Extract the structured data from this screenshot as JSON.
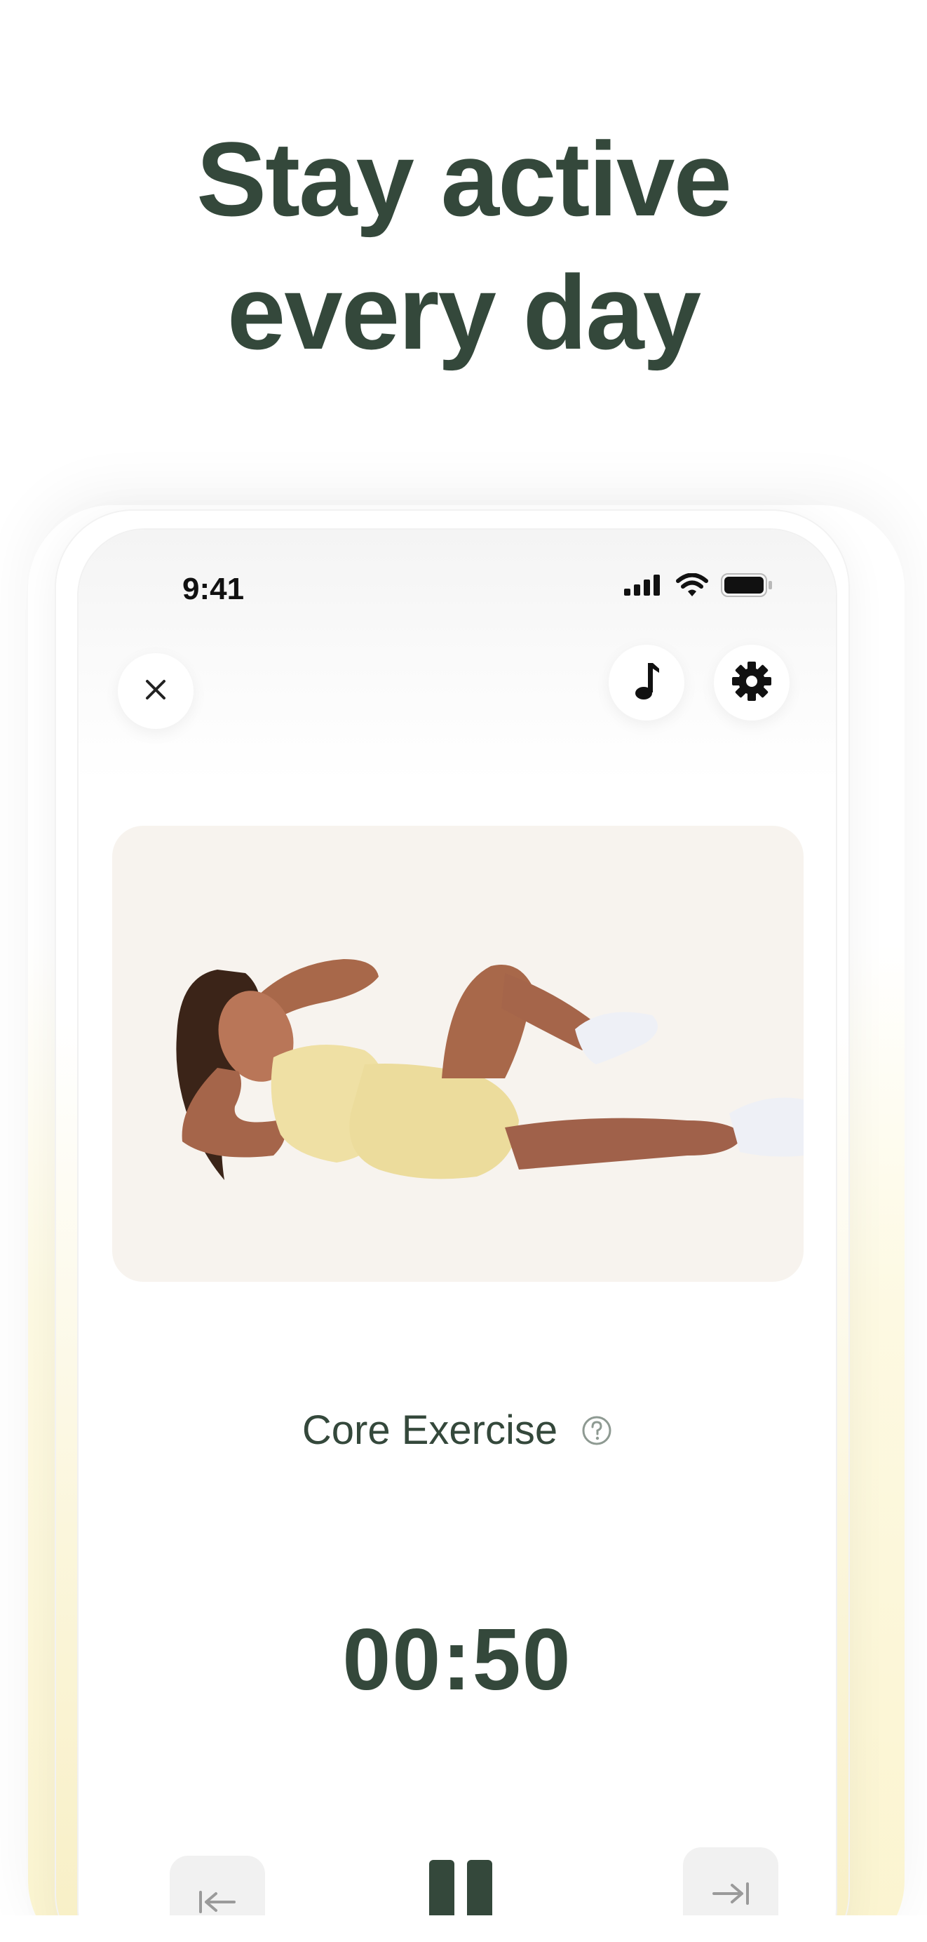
{
  "headline": {
    "line1": "Stay active",
    "line2": "every day"
  },
  "status_bar": {
    "time": "9:41",
    "icons": [
      "signal-icon",
      "wifi-icon",
      "battery-icon"
    ]
  },
  "top_controls": {
    "close": "close-icon",
    "music": "music-note-icon",
    "settings": "gear-icon"
  },
  "exercise": {
    "name": "Core Exercise",
    "help_icon": "question-icon",
    "timer": "00:50",
    "image_background": "#f7f3ee"
  },
  "bottom_controls": {
    "previous": "skip-back-icon",
    "pause": "pause-icon",
    "next": "skip-forward-icon"
  },
  "colors": {
    "accent": "#34483b",
    "card_bg": "#f7f3ee",
    "frame_tint": "#f8efc4"
  }
}
